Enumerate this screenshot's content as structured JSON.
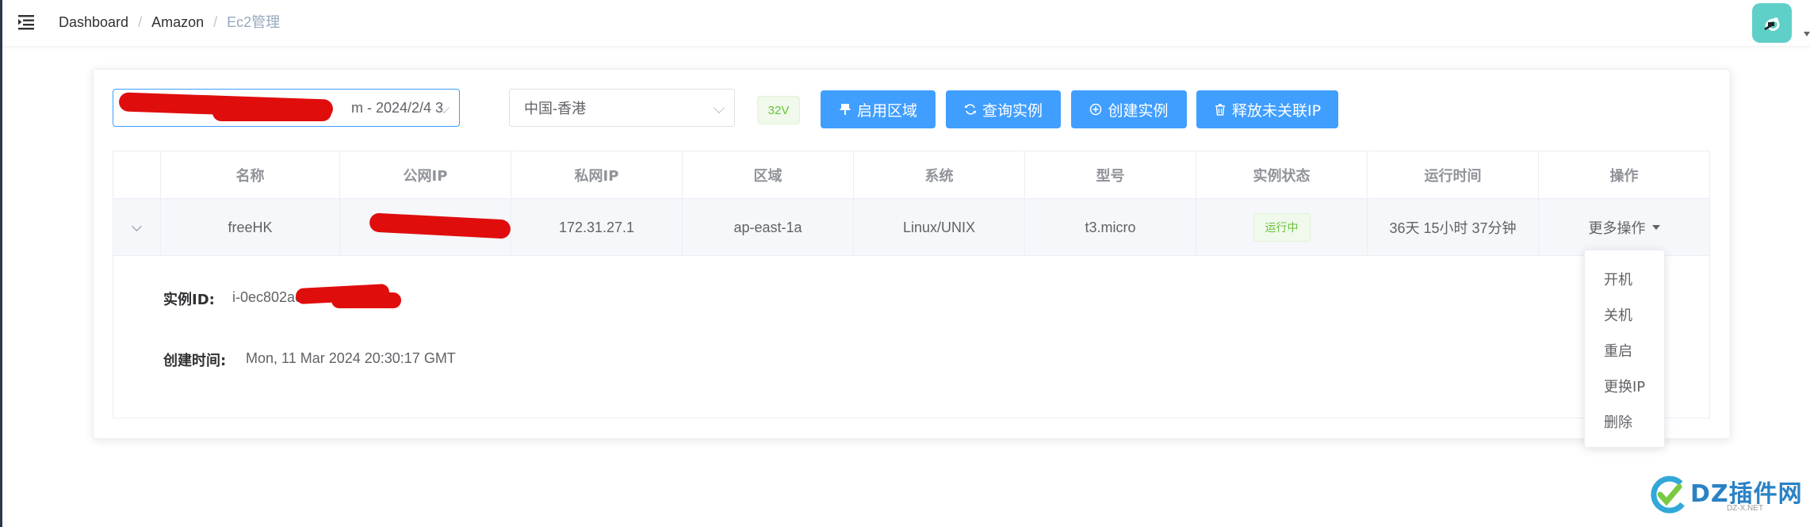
{
  "breadcrumb": [
    "Dashboard",
    "Amazon",
    "Ec2管理"
  ],
  "toolbar": {
    "account_select_value": "m - 2024/2/4 3",
    "region_select_value": "中国-香港",
    "version_tag": "32V",
    "buttons": {
      "enable_region": "启用区域",
      "query_instances": "查询实例",
      "create_instance": "创建实例",
      "release_ip": "释放未关联IP"
    }
  },
  "table": {
    "columns": [
      "",
      "名称",
      "公网IP",
      "私网IP",
      "区域",
      "系统",
      "型号",
      "实例状态",
      "运行时间",
      "操作"
    ],
    "row": {
      "name": "freeHK",
      "public_ip": "",
      "private_ip": "172.31.27.1",
      "zone": "ap-east-1a",
      "system": "Linux/UNIX",
      "model": "t3.micro",
      "status": "运行中",
      "uptime": "36天 15小时 37分钟",
      "actions_label": "更多操作"
    },
    "detail": {
      "instance_id_label": "实例ID:",
      "instance_id_value": "i-0ec802ac",
      "created_label": "创建时间:",
      "created_value": "Mon, 11 Mar 2024 20:30:17 GMT"
    }
  },
  "dropdown_menu": [
    "开机",
    "关机",
    "重启",
    "更换IP",
    "删除"
  ],
  "watermark": {
    "text": "DZ插件网",
    "sub": "DZ-X.NET"
  },
  "colors": {
    "primary": "#409eff",
    "success": "#67c23a",
    "redaction": "#e00d0d",
    "avatar": "#5ed0c8"
  }
}
